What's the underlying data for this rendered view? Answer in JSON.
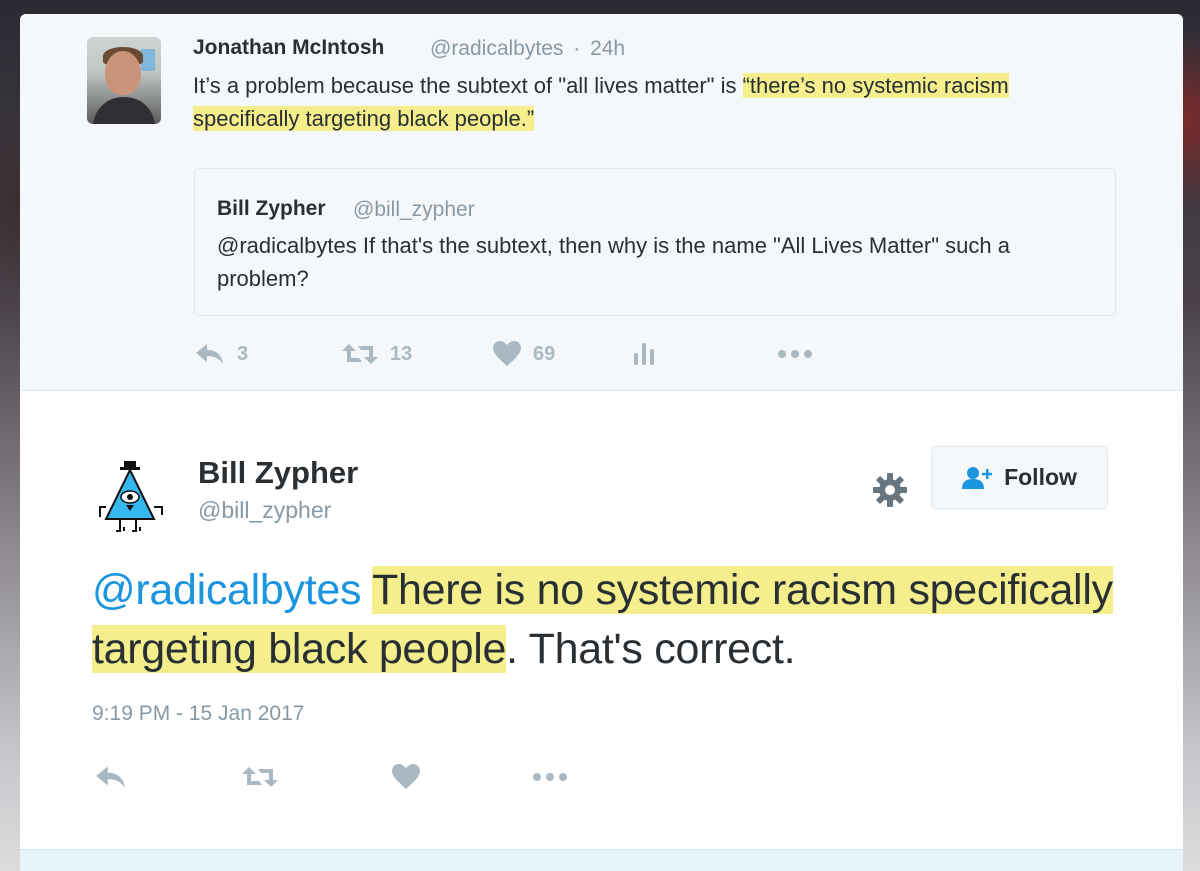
{
  "quoted_reply": {
    "author_name": "Jonathan McIntosh",
    "author_handle": "@radicalbytes",
    "separator": "·",
    "time_ago": "24h",
    "text_plain": "It’s a problem because the subtext of \"all lives matter\" is ",
    "text_highlight": "“there’s no systemic racism specifically targeting black people.”",
    "quote": {
      "author_name": "Bill Zypher",
      "author_handle": "@bill_zypher",
      "text": "@radicalbytes If that's the subtext, then why is the name \"All Lives Matter\" such a problem?"
    },
    "actions": {
      "reply_count": "3",
      "retweet_count": "13",
      "like_count": "69"
    }
  },
  "main_tweet": {
    "author_name": "Bill Zypher",
    "author_handle": "@bill_zypher",
    "follow_label": "Follow",
    "mention": "@radicalbytes",
    "text_space": " ",
    "text_highlight": "There is no systemic racism specifically targeting black people",
    "text_rest": ". That's correct.",
    "timestamp": "9:19 PM - 15 Jan 2017"
  },
  "icons": {
    "reply": "reply-icon",
    "retweet": "retweet-icon",
    "like": "heart-icon",
    "analytics": "analytics-icon",
    "more": "more-icon",
    "settings": "gear-icon",
    "follow": "add-user-icon"
  },
  "colors": {
    "highlight": "#f4ef8c",
    "link": "#1b95e0",
    "muted": "#8899a6",
    "icon_gray": "#aab8c2"
  }
}
